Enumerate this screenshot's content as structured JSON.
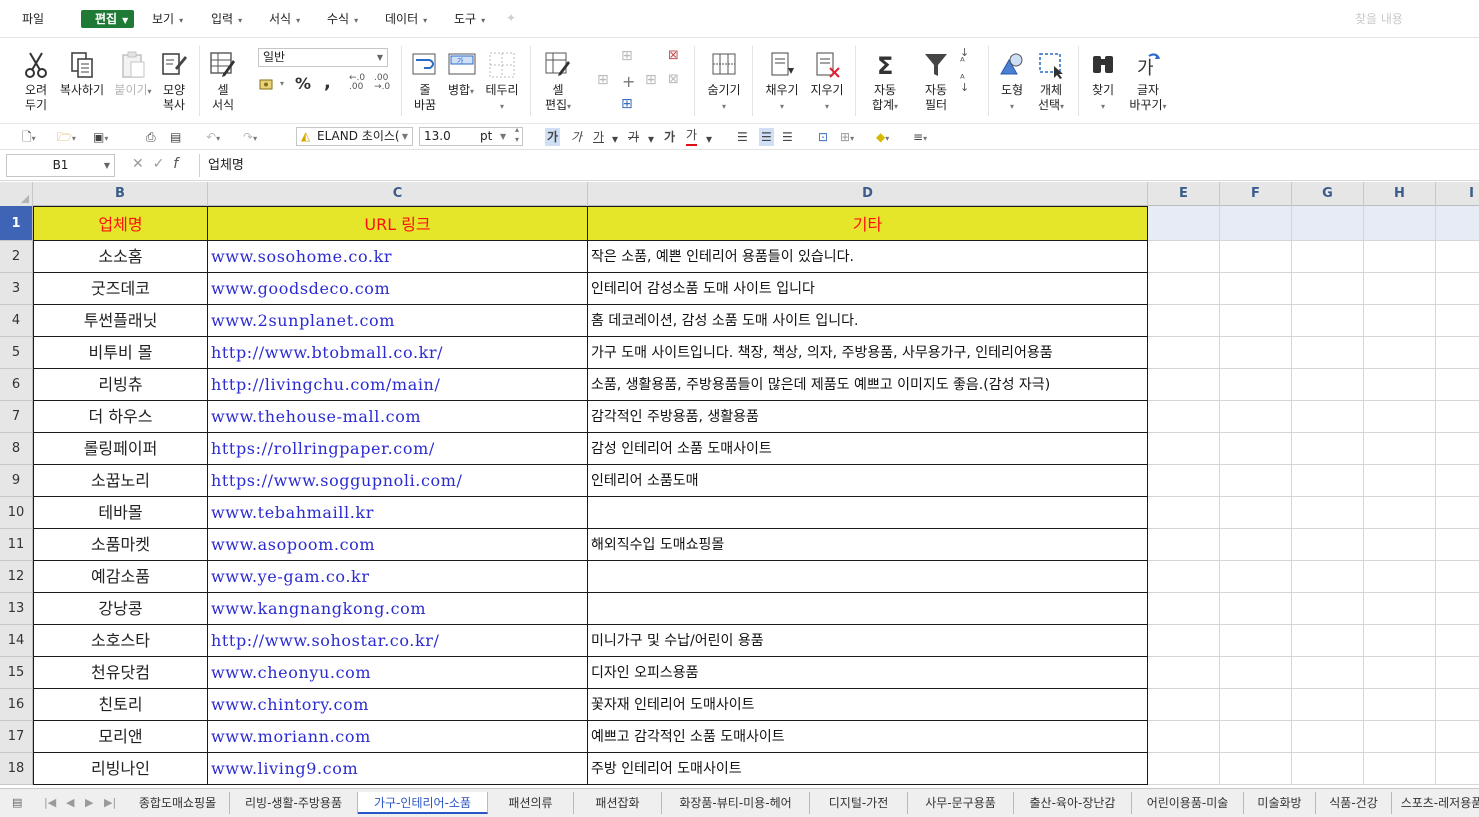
{
  "menubar": {
    "file": "파일",
    "edit": "편집",
    "view": "보기",
    "insert": "입력",
    "format": "서식",
    "formula": "수식",
    "data": "데이터",
    "tools": "도구",
    "search_placeholder": "찾을 내용"
  },
  "ribbon": {
    "cut": [
      "오려",
      "두기"
    ],
    "copy": "복사하기",
    "paste": "붙이기",
    "format_copy": [
      "모양",
      "복사"
    ],
    "cell_format": [
      "셀",
      "서식"
    ],
    "number_format": "일반",
    "percent": "%",
    "comma": ",",
    "wrap": [
      "줄",
      "바꿈"
    ],
    "merge": "병합",
    "border": "테두리",
    "cell_edit": [
      "셀",
      "편집"
    ],
    "hide": "숨기기",
    "fill": "채우기",
    "clear": "지우기",
    "autosum": [
      "자동",
      "합계"
    ],
    "autofilter": [
      "자동",
      "필터"
    ],
    "shape": "도형",
    "select_object": [
      "개체",
      "선택"
    ],
    "find": "찾기",
    "replace": [
      "글자",
      "바꾸기"
    ]
  },
  "toolbar": {
    "font_name": "ELAND 초이스(",
    "font_size": "13.0",
    "font_unit": "pt",
    "bold_glyph": "가",
    "italic_glyph": "가",
    "underline_glyph": "가",
    "strike_glyph": "가",
    "outline_glyph": "가",
    "color_glyph": "가"
  },
  "formula_bar": {
    "cell_ref": "B1",
    "content": "업체명"
  },
  "columns": [
    "B",
    "C",
    "D",
    "E",
    "F",
    "G",
    "H",
    "I"
  ],
  "header_row": {
    "row_num": "1",
    "b": "업체명",
    "c": "URL 링크",
    "d": "기타"
  },
  "rows": [
    {
      "num": "2",
      "name": "소소홈",
      "url": "www.sosohome.co.kr",
      "note": "작은 소품, 예쁜 인테리어 용품들이 있습니다."
    },
    {
      "num": "3",
      "name": "굿즈데코",
      "url": "www.goodsdeco.com",
      "note": "인테리어 감성소품 도매 사이트 입니다"
    },
    {
      "num": "4",
      "name": "투썬플래닛",
      "url": "www.2sunplanet.com",
      "note": "홈 데코레이션, 감성 소품 도매 사이트 입니다."
    },
    {
      "num": "5",
      "name": "비투비 몰",
      "url": "http://www.btobmall.co.kr/",
      "note": "가구 도매 사이트입니다. 책장, 책상, 의자, 주방용품, 사무용가구, 인테리어용품"
    },
    {
      "num": "6",
      "name": "리빙츄",
      "url": "http://livingchu.com/main/",
      "note": "소품, 생활용품, 주방용품들이 많은데 제품도 예쁘고 이미지도 좋음.(감성 자극)"
    },
    {
      "num": "7",
      "name": "더 하우스",
      "url": "www.thehouse-mall.com",
      "note": "감각적인 주방용품, 생활용품"
    },
    {
      "num": "8",
      "name": "롤링페이퍼",
      "url": "https://rollringpaper.com/",
      "note": "감성 인테리어 소품 도매사이트"
    },
    {
      "num": "9",
      "name": "소꿉노리",
      "url": "https://www.soggupnoli.com/",
      "note": "인테리어 소품도매"
    },
    {
      "num": "10",
      "name": "테바몰",
      "url": "www.tebahmaill.kr",
      "note": ""
    },
    {
      "num": "11",
      "name": "소품마켓",
      "url": "www.asopoom.com",
      "note": "해외직수입 도매쇼핑몰"
    },
    {
      "num": "12",
      "name": "예감소품",
      "url": "www.ye-gam.co.kr",
      "note": ""
    },
    {
      "num": "13",
      "name": "강낭콩",
      "url": "www.kangnangkong.com",
      "note": ""
    },
    {
      "num": "14",
      "name": "소호스타",
      "url": "http://www.sohostar.co.kr/",
      "note": "미니가구 및 수납/어린이 용품"
    },
    {
      "num": "15",
      "name": "천유닷컴",
      "url": "www.cheonyu.com",
      "note": "디자인 오피스용품"
    },
    {
      "num": "16",
      "name": "친토리",
      "url": "www.chintory.com",
      "note": "꽃자재 인테리어 도매사이트"
    },
    {
      "num": "17",
      "name": "모리앤",
      "url": "www.moriann.com",
      "note": "예쁘고 감각적인 소품 도매사이트"
    },
    {
      "num": "18",
      "name": "리빙나인",
      "url": "www.living9.com",
      "note": "주방 인테리어 도매사이트"
    }
  ],
  "sheet_tabs": [
    {
      "label": "종합도매쇼핑몰",
      "active": false
    },
    {
      "label": "리빙-생활-주방용품",
      "active": false
    },
    {
      "label": "가구-인테리어-소품",
      "active": true
    },
    {
      "label": "패션의류",
      "active": false
    },
    {
      "label": "패션잡화",
      "active": false
    },
    {
      "label": "화장품-뷰티-미용-헤어",
      "active": false
    },
    {
      "label": "디지털-가전",
      "active": false
    },
    {
      "label": "사무-문구용품",
      "active": false
    },
    {
      "label": "출산-육아-장난감",
      "active": false
    },
    {
      "label": "어린이용품-미술",
      "active": false
    },
    {
      "label": "미술화방",
      "active": false
    },
    {
      "label": "식품-건강",
      "active": false
    },
    {
      "label": "스포츠-레저용품",
      "active": false
    }
  ],
  "colors": {
    "header_fill": "#e5e62a",
    "header_text": "#ff1010",
    "url_text": "#2b2bd1",
    "selected_row": "#3f64b5",
    "edit_tab": "#1f7a35",
    "active_sheet": "#2a55c4"
  }
}
